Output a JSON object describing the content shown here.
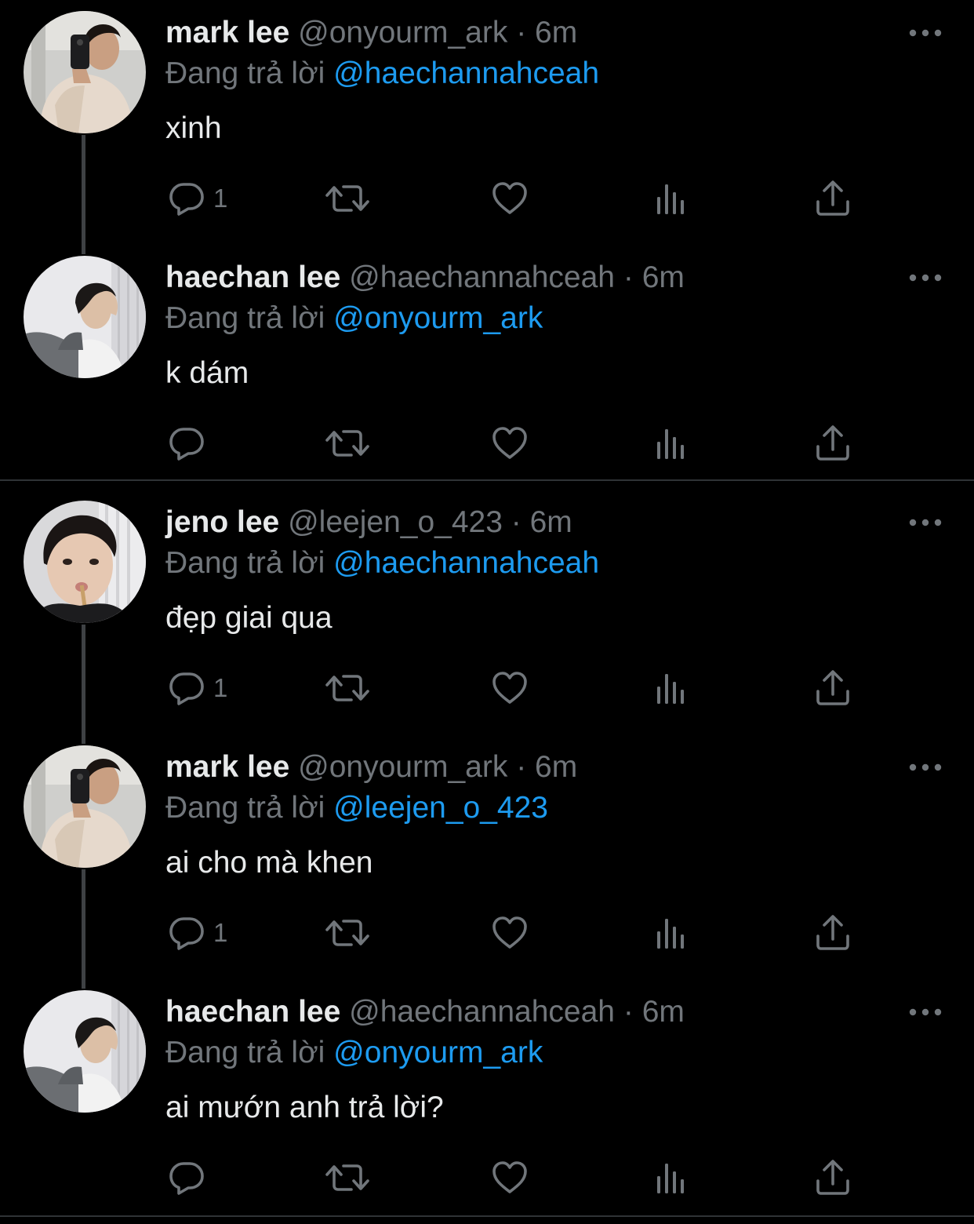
{
  "colors": {
    "background": "#000000",
    "text_primary": "#e7e9ea",
    "text_secondary": "#71767b",
    "mention_blue": "#1d9bf0",
    "thread_line": "#3e4144",
    "separator": "#2f3336"
  },
  "icons": {
    "reply": "speech-bubble-icon",
    "retweet": "retweet-arrows-icon",
    "like": "heart-icon",
    "analytics": "bar-chart-icon",
    "share": "share-upload-icon",
    "more": "more-dots-icon"
  },
  "tweets": [
    {
      "name": "mark lee",
      "handle": "@onyourm_ark",
      "dot": "·",
      "time": "6m",
      "reply_prefix": "Đang trả lời",
      "reply_to": "@haechannahceah",
      "text": "xinh",
      "reply_count": "1",
      "avatar": "mark"
    },
    {
      "name": "haechan lee",
      "handle": "@haechannahceah",
      "dot": "·",
      "time": "6m",
      "reply_prefix": "Đang trả lời",
      "reply_to": "@onyourm_ark",
      "text": "k dám",
      "reply_count": "",
      "avatar": "haechan"
    },
    {
      "name": "jeno lee",
      "handle": "@leejen_o_423",
      "dot": "·",
      "time": "6m",
      "reply_prefix": "Đang trả lời",
      "reply_to": "@haechannahceah",
      "text": "đẹp giai qua",
      "reply_count": "1",
      "avatar": "jeno"
    },
    {
      "name": "mark lee",
      "handle": "@onyourm_ark",
      "dot": "·",
      "time": "6m",
      "reply_prefix": "Đang trả lời",
      "reply_to": "@leejen_o_423",
      "text": "ai cho mà khen",
      "reply_count": "1",
      "avatar": "mark"
    },
    {
      "name": "haechan lee",
      "handle": "@haechannahceah",
      "dot": "·",
      "time": "6m",
      "reply_prefix": "Đang trả lời",
      "reply_to": "@onyourm_ark",
      "text": "ai mướn anh trả lời?",
      "reply_count": "",
      "avatar": "haechan"
    }
  ]
}
